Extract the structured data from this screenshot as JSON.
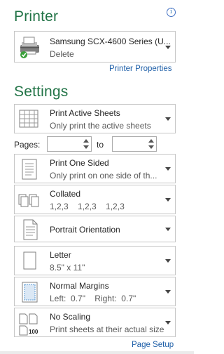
{
  "printer": {
    "title": "Printer",
    "name": "Samsung SCX-4600 Series (U...",
    "status": "Delete",
    "properties_link": "Printer Properties",
    "info_glyph": "i"
  },
  "settings": {
    "title": "Settings",
    "print_what": {
      "title": "Print Active Sheets",
      "subtitle": "Only print the active sheets"
    },
    "pages": {
      "label": "Pages:",
      "from_value": "",
      "to_label": "to",
      "to_value": ""
    },
    "sides": {
      "title": "Print One Sided",
      "subtitle": "Only print on one side of th..."
    },
    "collation": {
      "title": "Collated",
      "subtitle": "1,2,3    1,2,3    1,2,3"
    },
    "orientation": {
      "title": "Portrait Orientation"
    },
    "paper": {
      "title": "Letter",
      "subtitle": "8.5\" x 11\""
    },
    "margins": {
      "title": "Normal Margins",
      "subtitle": "Left:  0.7\"    Right:  0.7\""
    },
    "scaling": {
      "title": "No Scaling",
      "subtitle": "Print sheets at their actual size",
      "icon_text": "100"
    },
    "page_setup_link": "Page Setup"
  },
  "colors": {
    "accent": "#217346",
    "link": "#1e5fa8",
    "border": "#c6c6c6"
  }
}
